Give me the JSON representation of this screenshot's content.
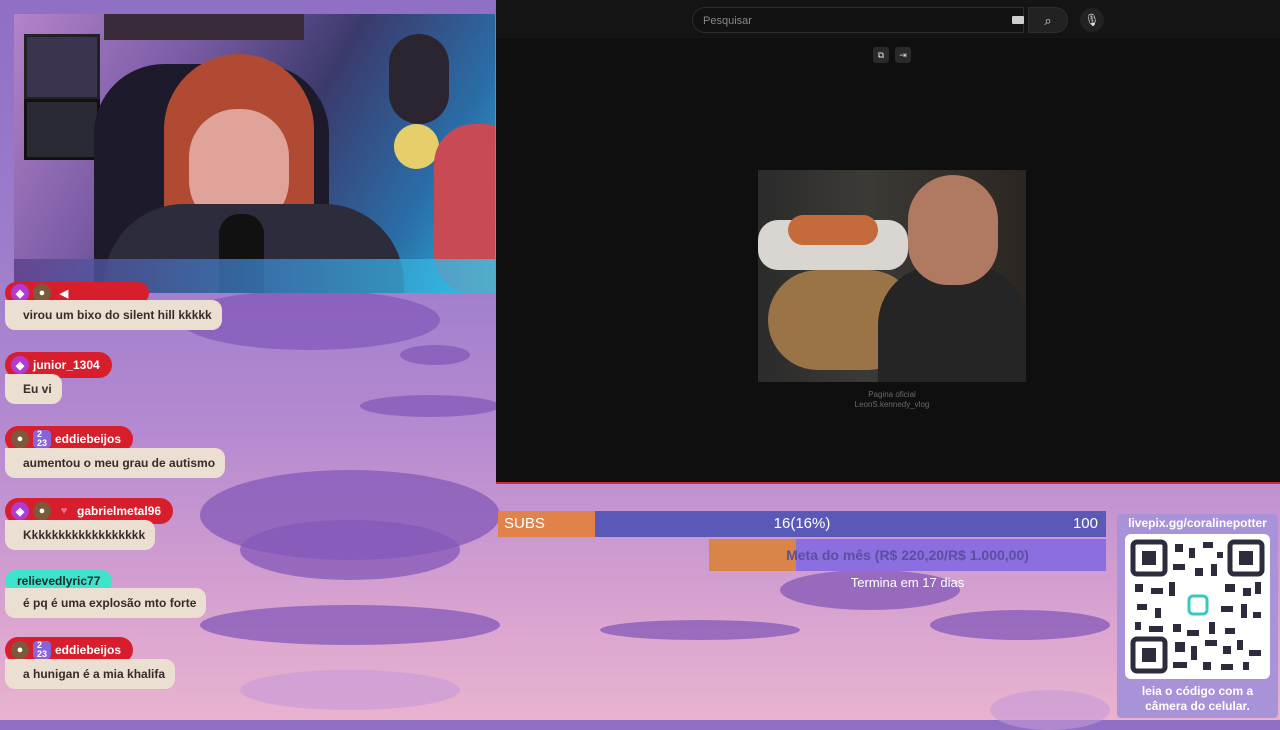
{
  "youtube": {
    "search_placeholder": "Pesquisar",
    "video_caption_line1": "Pagina oficial",
    "video_caption_line2": "LeonS.kennedy_vlog",
    "accent_red": "#d4283a"
  },
  "chat": [
    {
      "user": "",
      "text": "virou um bixo do silent hill kkkkk",
      "badges": [
        "gem-icon",
        "avatar-icon",
        "mute-icon"
      ]
    },
    {
      "user": "junior_1304",
      "text": "Eu vi",
      "badges": [
        "gem-icon"
      ]
    },
    {
      "user": "eddiebeijos",
      "text": "aumentou o meu grau de autismo",
      "badges": [
        "avatar-icon",
        "sub-badge-icon"
      ]
    },
    {
      "user": "gabrielmetal96",
      "text": "Kkkkkkkkkkkkkkkkkk",
      "badges": [
        "gem-icon",
        "avatar-icon",
        "heart-icon"
      ]
    },
    {
      "user": "relievedlyric77",
      "text": "é pq é uma explosão mto forte",
      "badges": []
    },
    {
      "user": "eddiebeijos",
      "text": "a hunigan é a mia khalifa",
      "badges": [
        "avatar-icon",
        "sub-badge-icon"
      ]
    }
  ],
  "subs": {
    "label": "SUBS",
    "progress_text": "16(16%)",
    "max": "100",
    "progress_fraction": 0.16,
    "bar_color": "#5b59b8",
    "fill_color": "#e2824b"
  },
  "meta": {
    "text": "Meta do mês (R$ 220,20/R$ 1.000,00)",
    "progress_fraction": 0.22,
    "footer": "Termina em 17 dias"
  },
  "qr": {
    "title": "livepix.gg/coralinepotter",
    "footer_line1": "leia o código com a",
    "footer_line2": "câmera do celular."
  }
}
